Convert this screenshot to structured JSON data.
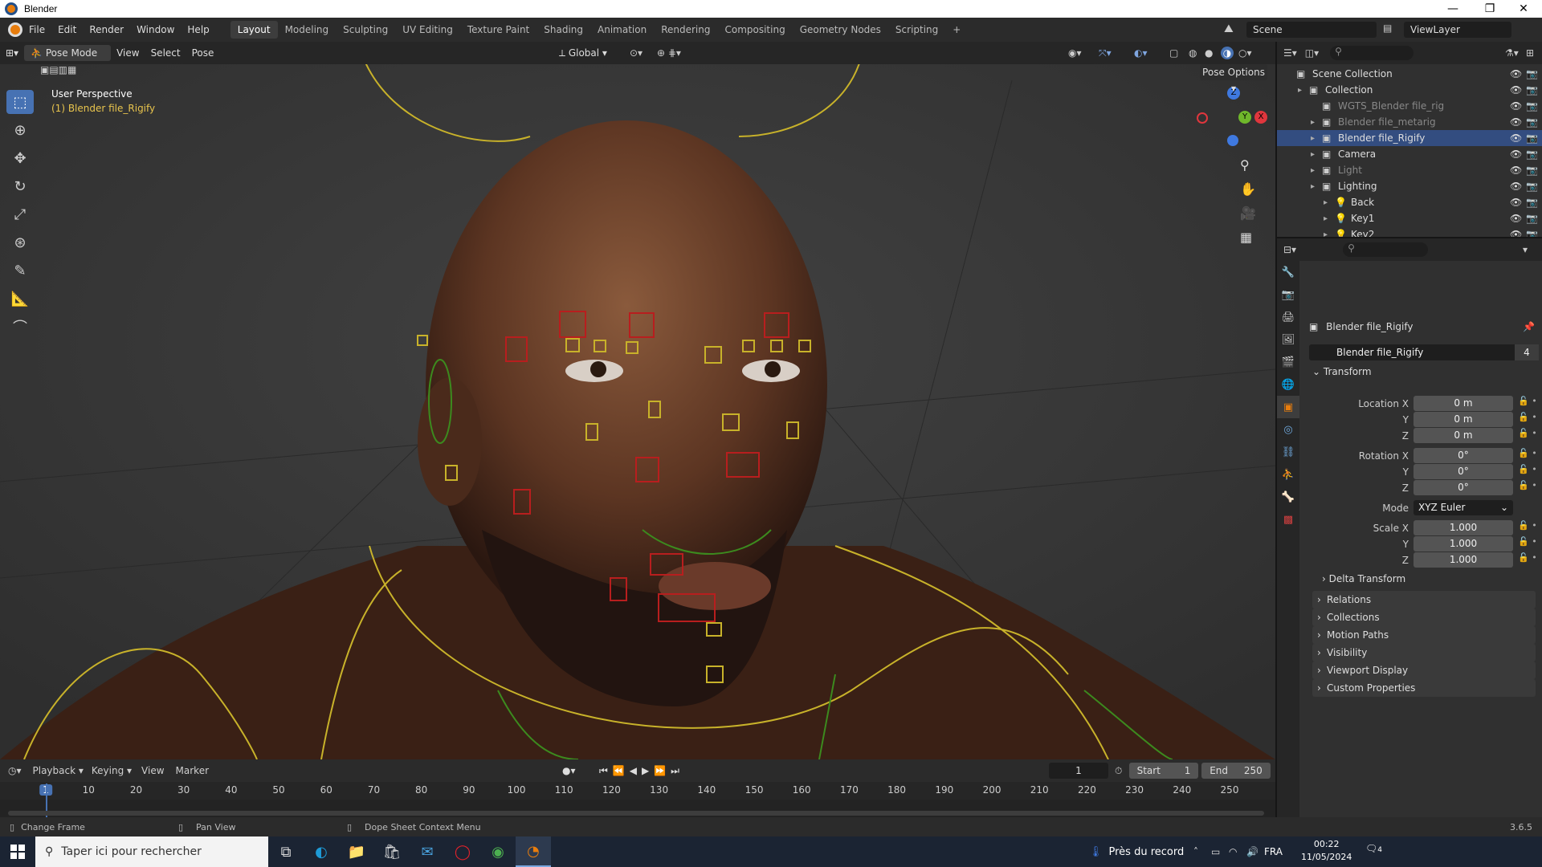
{
  "window": {
    "title": "Blender"
  },
  "menu": [
    "File",
    "Edit",
    "Render",
    "Window",
    "Help"
  ],
  "workspaces": [
    "Layout",
    "Modeling",
    "Sculpting",
    "UV Editing",
    "Texture Paint",
    "Shading",
    "Animation",
    "Rendering",
    "Compositing",
    "Geometry Nodes",
    "Scripting",
    "+"
  ],
  "scene": {
    "name": "Scene",
    "view_layer": "ViewLayer"
  },
  "viewport_header": {
    "mode": "Pose Mode",
    "menus": [
      "View",
      "Select",
      "Pose"
    ],
    "orientation": "Global",
    "pose_options": "Pose Options"
  },
  "viewport": {
    "perspective": "User Perspective",
    "object": "(1) Blender file_Rigify",
    "gizmo_axes": [
      "Z",
      "Y",
      "X"
    ]
  },
  "outliner": {
    "rows": [
      {
        "label": "Scene Collection",
        "indent": 0,
        "style": "normal"
      },
      {
        "label": "Collection",
        "indent": 1,
        "style": "normal"
      },
      {
        "label": "WGTS_Blender file_rig",
        "indent": 2,
        "style": "dim"
      },
      {
        "label": "Blender file_metarig",
        "indent": 2,
        "style": "dim"
      },
      {
        "label": "Blender file_Rigify",
        "indent": 2,
        "style": "sel"
      },
      {
        "label": "Camera",
        "indent": 2,
        "style": "normal"
      },
      {
        "label": "Light",
        "indent": 2,
        "style": "dim"
      },
      {
        "label": "Lighting",
        "indent": 2,
        "style": "normal"
      },
      {
        "label": "Back",
        "indent": 3,
        "style": "normal"
      },
      {
        "label": "Key1",
        "indent": 3,
        "style": "normal"
      },
      {
        "label": "Key2",
        "indent": 3,
        "style": "normal"
      }
    ]
  },
  "properties": {
    "object_name": "Blender file_Rigify",
    "datablock": "Blender file_Rigify",
    "users": "4",
    "transform_label": "Transform",
    "location": {
      "label": "Location X",
      "x": "0 m",
      "y": "0 m",
      "z": "0 m"
    },
    "rotation": {
      "label": "Rotation X",
      "x": "0°",
      "y": "0°",
      "z": "0°"
    },
    "mode_label": "Mode",
    "mode": "XYZ Euler",
    "scale": {
      "label": "Scale X",
      "x": "1.000",
      "y": "1.000",
      "z": "1.000"
    },
    "axis": {
      "y": "Y",
      "z": "Z"
    },
    "sections": [
      "Delta Transform",
      "Relations",
      "Collections",
      "Motion Paths",
      "Visibility",
      "Viewport Display",
      "Custom Properties"
    ]
  },
  "timeline": {
    "menus": [
      "Playback",
      "Keying",
      "View",
      "Marker"
    ],
    "current_frame": "1",
    "start_label": "Start",
    "start": "1",
    "end_label": "End",
    "end": "250",
    "ticks": [
      "1",
      "10",
      "20",
      "30",
      "40",
      "50",
      "60",
      "70",
      "80",
      "90",
      "100",
      "110",
      "120",
      "130",
      "140",
      "150",
      "160",
      "170",
      "180",
      "190",
      "200",
      "210",
      "220",
      "230",
      "240",
      "250"
    ]
  },
  "status": {
    "left": "Change Frame",
    "mid": "Pan View",
    "right": "Dope Sheet Context Menu",
    "version": "3.6.5"
  },
  "taskbar": {
    "search_placeholder": "Taper ici pour rechercher",
    "weather": "Près du record",
    "lang": "FRA",
    "time": "00:22",
    "date": "11/05/2024",
    "notifications": "4"
  },
  "colors": {
    "accent": "#4772b3",
    "selection": "#334d80",
    "blender_orange": "#e87d0d"
  }
}
